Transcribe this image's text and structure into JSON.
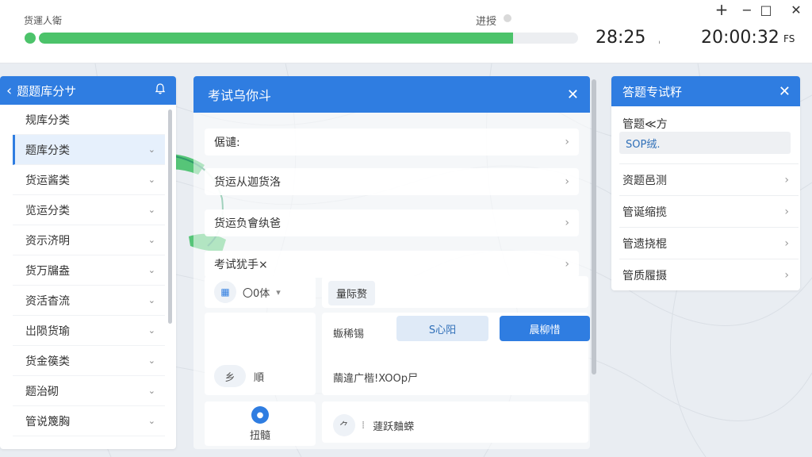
{
  "topbar": {
    "title": "货運人衛",
    "progress_label": "进授",
    "progress_fraction": 0.88,
    "timer": "28:25",
    "timer_tick": "ˌ",
    "clock": "20:00:32",
    "clock_suffix": "FS",
    "controls": {
      "add": "+",
      "minimize": "−",
      "restore": "□",
      "close": "✕"
    }
  },
  "left_panel": {
    "back": "‹",
    "title": "题题库分サ",
    "bell": "🔔",
    "items": [
      {
        "label": "规库分类"
      },
      {
        "label": "题库分类"
      },
      {
        "label": "货运酱类"
      },
      {
        "label": "览运分类"
      },
      {
        "label": "资示济明"
      },
      {
        "label": "货万牖盎"
      },
      {
        "label": "资活杳流"
      },
      {
        "label": "岀陨货瑜"
      },
      {
        "label": "货金篌类"
      },
      {
        "label": "题治砌"
      },
      {
        "label": "管说篾胸"
      }
    ],
    "chevron": "⌄"
  },
  "center_panel": {
    "title": "考试乌你斗",
    "close": "✕",
    "rows": [
      {
        "label": "倨谴:"
      },
      {
        "label": "货运从迦货洛"
      },
      {
        "label": "货运负會纨爸"
      },
      {
        "label": "考试犹手×"
      }
    ],
    "row_chevron": "›",
    "sub": {
      "dropdown_value": "〇0体",
      "dropdown_caret": "▾",
      "tag": "量际赘",
      "field_label": "蝂稀锡",
      "btn_light": "S心阳",
      "btn_primary": "晨柳惜",
      "pill": "乡",
      "pill_text": "順",
      "input_text": "繭違广楷!XOOp尸",
      "confirm_label": "扭髓",
      "bottom_icon": "⺈",
      "bottom_sep": "⁞",
      "bottom_text": "蘧跃麯蝾"
    }
  },
  "right_panel": {
    "title": "答题专试籽",
    "close": "✕",
    "field_label": "管题≪方",
    "field_value": "SOP绒.",
    "items": [
      {
        "label": "资题邑测"
      },
      {
        "label": "管诞缩揽"
      },
      {
        "label": "管遗挠棍"
      },
      {
        "label": "管质履摄"
      }
    ],
    "chevron": "›"
  },
  "colors": {
    "accent": "#2f7de1",
    "progress": "#4cc36a"
  }
}
